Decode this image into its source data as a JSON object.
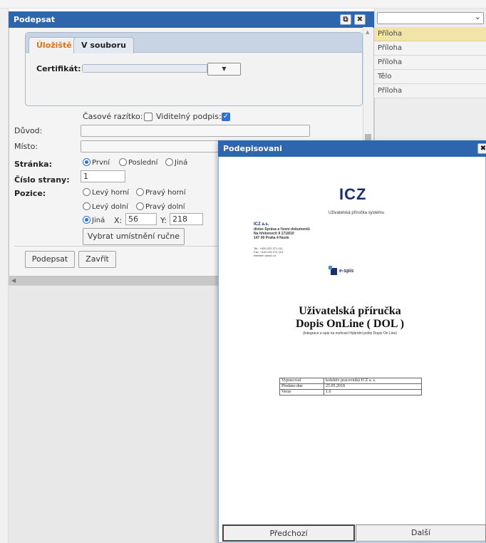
{
  "main_dialog": {
    "title": "Podepsat",
    "tabs": [
      "Úložiště",
      "V souboru"
    ],
    "certificate_label": "Certifikát:",
    "timestamp_label": "Časové razítko:",
    "visible_signature_label": "Viditelný podpis:",
    "timestamp_checked": false,
    "visible_signature_checked": true,
    "reason_label": "Důvod:",
    "place_label": "Místo:",
    "page_label": "Stránka:",
    "page_options": [
      "První",
      "Poslední",
      "Jiná"
    ],
    "page_selected": "První",
    "page_number_label": "Číslo strany:",
    "page_number_value": "1",
    "position_label": "Pozice:",
    "position_options": [
      "Levý horní",
      "Pravý horní",
      "Levý dolní",
      "Pravý dolní",
      "Jiná"
    ],
    "position_selected": "Jiná",
    "x_label": "X:",
    "x_value": "56",
    "y_label": "Y:",
    "y_value": "218",
    "manual_placement_button": "Vybrat umístnění ručne",
    "sign_button": "Podepsat",
    "close_button": "Zavřít"
  },
  "right_panel": {
    "items": [
      "Příloha",
      "Příloha",
      "Příloha",
      "Tělo",
      "Příloha"
    ],
    "selected_index": 0
  },
  "signing_dialog": {
    "title": "Podepisovani",
    "close_glyph": "✖",
    "prev_button": "Předchozí",
    "next_button": "Další",
    "document": {
      "logo": "ICZ",
      "logo_caption": "Uživatelská příručka systému",
      "company": "ICZ a.s.",
      "address_lines": [
        "divize Správa a řízení dokumentů",
        "Na hřebenech II 1718/10",
        "147 00 Praha 4 Nusle"
      ],
      "contact_lines": [
        "Tel.: +420-222 271 111",
        "Fax: +420-222 271 112",
        "Internet: www.i.cz"
      ],
      "brand": "e-spis",
      "title_line1": "Uživatelská příručka",
      "title_line2": "Dopis OnLine ( DOL )",
      "subtitle": "(Integrace e-spis na rozhraní Hybridní pošty Dopis On Line)",
      "table": [
        [
          "Vypracoval",
          "kolektiv pracovníků ICZ a. s."
        ],
        [
          "Předáno dne",
          "25.05.2018"
        ],
        [
          "Verze",
          "1.0"
        ]
      ]
    }
  },
  "colors": {
    "title_bar": "#2e66ad",
    "active_tab_text": "#e0701c",
    "selected_row": "#f1e4a6",
    "check_blue": "#2f6fd6"
  }
}
